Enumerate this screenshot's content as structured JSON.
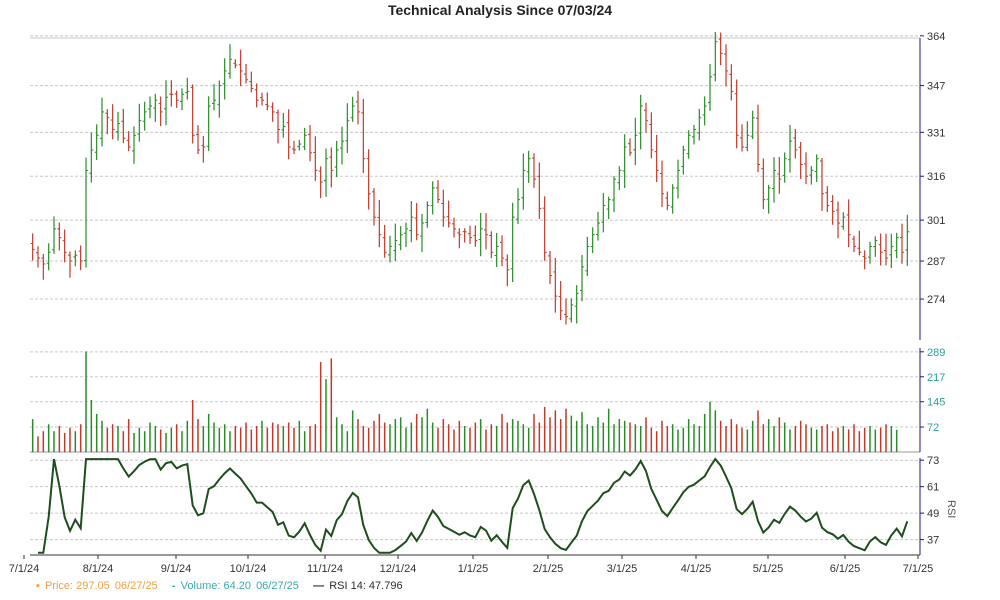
{
  "title": "Technical Analysis Since 07/03/24",
  "legend": {
    "price_label": "Price: 297.05",
    "price_date": "06/27/25",
    "volume_label": "Volume: 64.20",
    "volume_date": "06/27/25",
    "rsi_label": "RSI 14: 47.796"
  },
  "colors": {
    "up": "#2a8a2a",
    "down": "#c0392b",
    "rsi": "#1e4d1e",
    "axis": "#1a1a80",
    "vol_tick": "#2aa0a0",
    "grid": "#c8c8c8"
  },
  "chart_data": {
    "type": "candlestick",
    "title": "Technical Analysis Since 07/03/24",
    "x_tick_labels": [
      "7/1/24",
      "8/1/24",
      "9/1/24",
      "10/1/24",
      "11/1/24",
      "12/1/24",
      "1/1/25",
      "2/1/25",
      "3/1/25",
      "4/1/25",
      "5/1/25",
      "6/1/25",
      "7/1/25"
    ],
    "price": {
      "y_ticks": [
        274,
        287,
        301,
        316,
        331,
        347,
        364
      ],
      "ylim": [
        260,
        366
      ],
      "closes": [
        291,
        288,
        286,
        290,
        298,
        295,
        290,
        287,
        289,
        287,
        318,
        325,
        330,
        338,
        336,
        332,
        334,
        329,
        326,
        330,
        335,
        338,
        340,
        342,
        338,
        343,
        344,
        342,
        344,
        345,
        330,
        325,
        326,
        340,
        342,
        347,
        352,
        356,
        354,
        352,
        349,
        346,
        342,
        342,
        340,
        338,
        332,
        333,
        326,
        325,
        327,
        330,
        324,
        318,
        314,
        322,
        318,
        325,
        328,
        335,
        340,
        338,
        322,
        310,
        302,
        296,
        290,
        292,
        294,
        296,
        298,
        302,
        296,
        300,
        306,
        312,
        308,
        302,
        300,
        298,
        296,
        297,
        295,
        294,
        298,
        296,
        290,
        292,
        288,
        284,
        302,
        308,
        318,
        322,
        315,
        305,
        290,
        282,
        275,
        270,
        268,
        272,
        276,
        285,
        292,
        296,
        300,
        306,
        308,
        315,
        318,
        326,
        324,
        330,
        340,
        335,
        325,
        318,
        310,
        306,
        312,
        318,
        325,
        330,
        332,
        336,
        340,
        350,
        362,
        358,
        352,
        345,
        330,
        326,
        330,
        336,
        320,
        308,
        312,
        318,
        315,
        322,
        328,
        325,
        320,
        316,
        318,
        322,
        310,
        306,
        304,
        300,
        302,
        296,
        292,
        290,
        288,
        292,
        294,
        290,
        288,
        292,
        295,
        290,
        297
      ],
      "volumes": [
        95,
        45,
        60,
        80,
        60,
        75,
        55,
        70,
        60,
        80,
        290,
        150,
        110,
        90,
        70,
        80,
        75,
        60,
        95,
        55,
        70,
        60,
        85,
        75,
        65,
        55,
        70,
        80,
        60,
        90,
        150,
        95,
        75,
        110,
        85,
        70,
        80,
        60,
        75,
        70,
        85,
        65,
        75,
        90,
        70,
        85,
        80,
        75,
        85,
        70,
        90,
        60,
        75,
        80,
        260,
        210,
        270,
        100,
        80,
        60,
        120,
        95,
        75,
        70,
        90,
        110,
        85,
        80,
        95,
        100,
        70,
        85,
        110,
        100,
        125,
        85,
        70,
        95,
        80,
        65,
        90,
        75,
        70,
        85,
        95,
        65,
        80,
        75,
        110,
        85,
        95,
        90,
        80,
        70,
        110,
        85,
        130,
        100,
        120,
        95,
        125,
        105,
        90,
        115,
        80,
        75,
        100,
        85,
        125,
        80,
        95,
        90,
        85,
        80,
        75,
        100,
        70,
        60,
        90,
        75,
        80,
        65,
        70,
        95,
        80,
        75,
        110,
        145,
        120,
        90,
        75,
        95,
        80,
        70,
        65,
        90,
        120,
        80,
        95,
        75,
        100,
        85,
        65,
        75,
        90,
        80,
        70,
        65,
        75,
        80,
        60,
        70,
        75,
        65,
        80,
        60,
        70,
        75,
        65,
        70,
        80,
        75,
        64
      ],
      "volume_y_ticks": [
        72,
        145,
        217,
        289
      ]
    },
    "rsi": {
      "label": "RSI",
      "y_ticks": [
        37,
        49,
        61,
        73
      ],
      "ylim": [
        30,
        74
      ]
    }
  }
}
